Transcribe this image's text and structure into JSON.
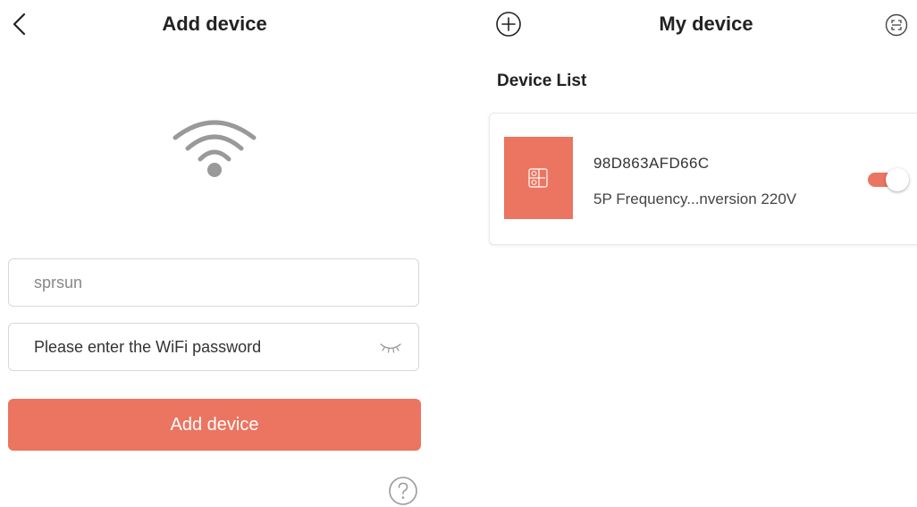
{
  "colors": {
    "accent": "#eb7560",
    "text": "#222222",
    "border": "#d8d8d8"
  },
  "add_device_screen": {
    "title": "Add device",
    "icons": {
      "back": "chevron-left-icon",
      "wifi": "wifi-icon",
      "show_password": "eye-closed-icon",
      "help": "question-circle-icon"
    },
    "ssid_input": {
      "value": "sprsun",
      "placeholder": ""
    },
    "password_input": {
      "value": "",
      "placeholder": "Please enter the WiFi password"
    },
    "add_button_label": "Add device"
  },
  "my_device_screen": {
    "title": "My device",
    "icons": {
      "add": "plus-circle-icon",
      "scan": "scan-icon"
    },
    "section_heading": "Device List",
    "devices": [
      {
        "id": "98D863AFD66C",
        "model": "5P Frequency...nversion 220V",
        "icon": "device-panel-icon",
        "power_on": true
      }
    ]
  }
}
